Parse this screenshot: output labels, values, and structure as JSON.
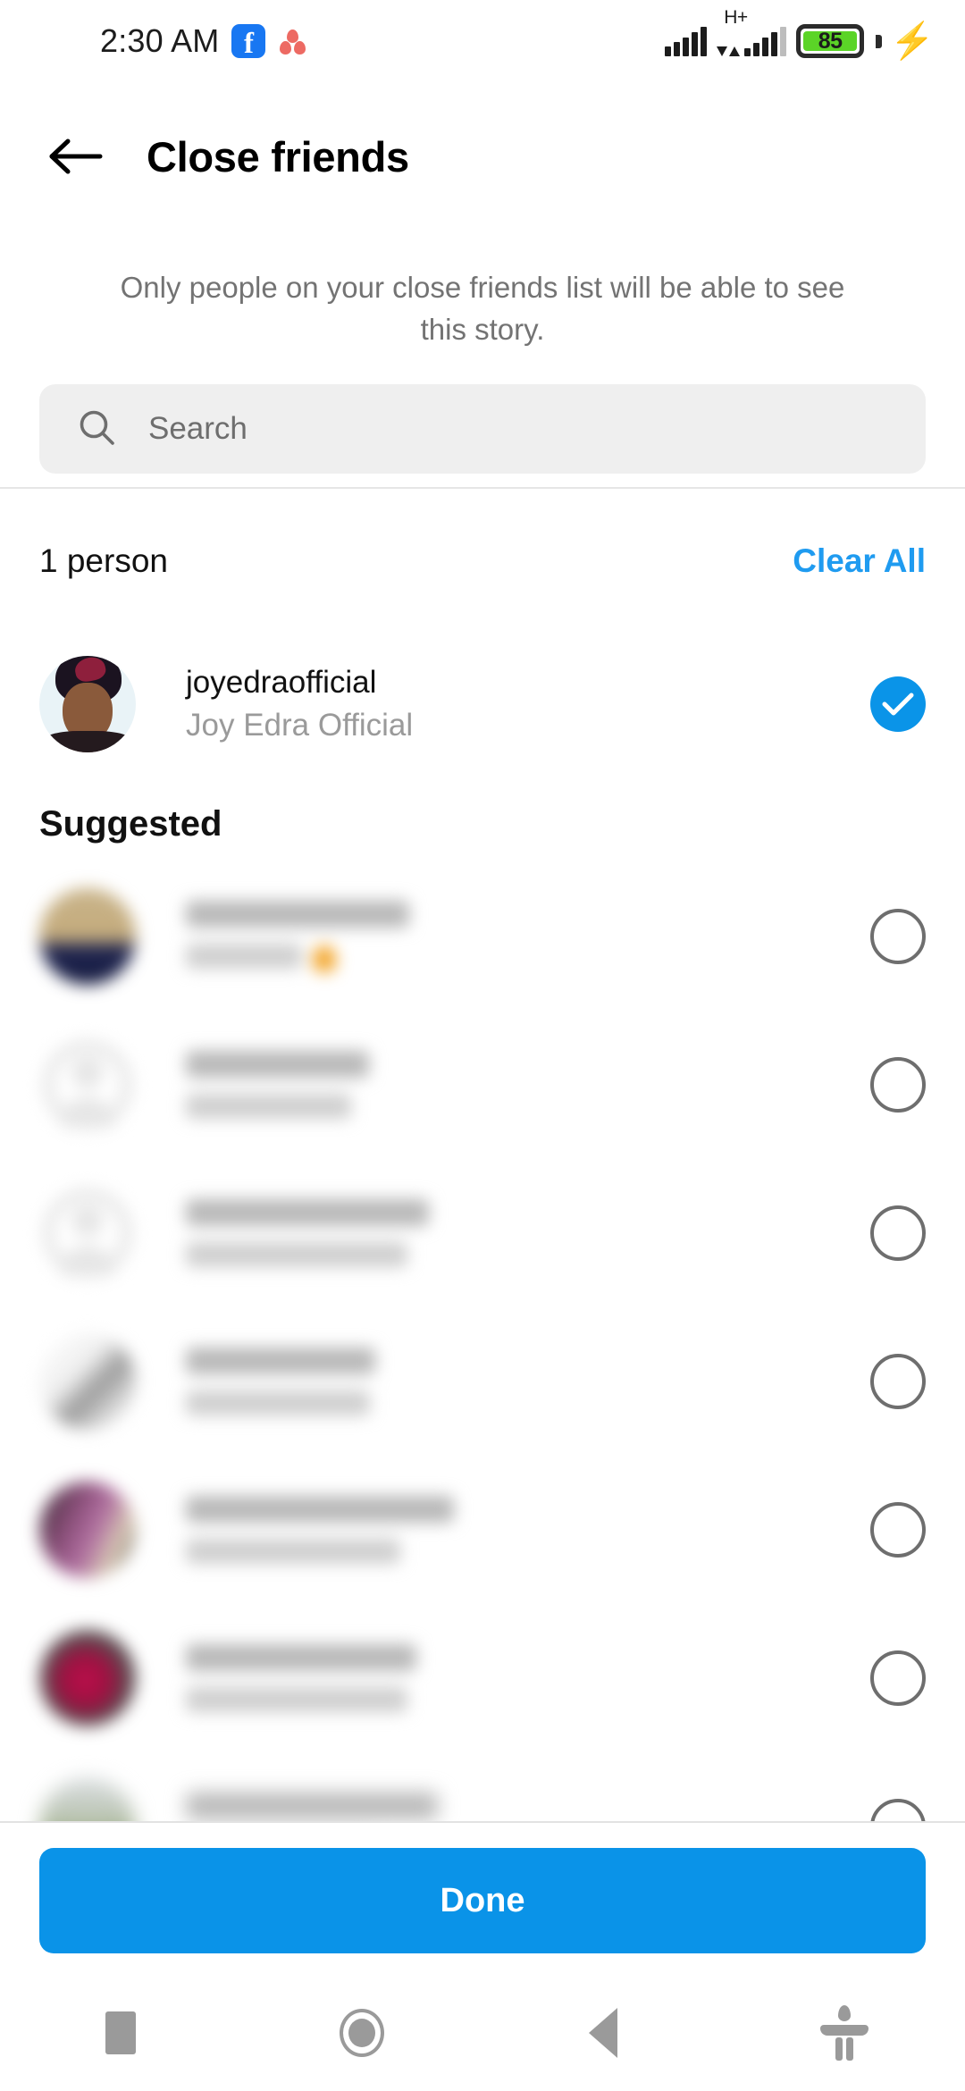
{
  "status_bar": {
    "time": "2:30 AM",
    "facebook_glyph": "f",
    "icons": [
      "facebook-icon",
      "cluster-dots-icon"
    ],
    "network_label": "H+",
    "battery_level": "85",
    "battery_color": "#5BD427",
    "charging": true
  },
  "header": {
    "back_icon": "back-arrow-icon",
    "title": "Close friends"
  },
  "description": "Only people on your close friends list will be able to see this story.",
  "search": {
    "icon": "search-icon",
    "placeholder": "Search",
    "value": ""
  },
  "list_summary": {
    "count_label": "1 person",
    "clear_all_label": "Clear All"
  },
  "selected": [
    {
      "username": "joyedraofficial",
      "fullname": "Joy Edra Official",
      "selected": true,
      "avatar": "photo-joy"
    }
  ],
  "suggested": {
    "title": "Suggested",
    "items": [
      {
        "username": "",
        "fullname": "",
        "selected": false,
        "avatar": "photo-tan-navy",
        "redacted": true,
        "has_emoji": true
      },
      {
        "username": "",
        "fullname": "",
        "selected": false,
        "avatar": "placeholder-silhouette",
        "redacted": true,
        "has_emoji": false
      },
      {
        "username": "",
        "fullname": "",
        "selected": false,
        "avatar": "placeholder-silhouette",
        "redacted": true,
        "has_emoji": false
      },
      {
        "username": "",
        "fullname": "",
        "selected": false,
        "avatar": "photo-light",
        "redacted": true,
        "has_emoji": false
      },
      {
        "username": "",
        "fullname": "",
        "selected": false,
        "avatar": "photo-purple",
        "redacted": true,
        "has_emoji": false
      },
      {
        "username": "",
        "fullname": "",
        "selected": false,
        "avatar": "photo-crimson",
        "redacted": true,
        "has_emoji": false
      },
      {
        "username": "",
        "fullname": "",
        "selected": false,
        "avatar": "photo-outdoor",
        "redacted": true,
        "has_emoji": false
      }
    ]
  },
  "footer": {
    "done_label": "Done",
    "done_color": "#0A93E8"
  },
  "nav_bar": {
    "items": [
      "recents-square-icon",
      "home-circle-icon",
      "back-triangle-icon",
      "accessibility-icon"
    ]
  },
  "colors": {
    "accent_blue": "#0A94E8",
    "link_blue": "#1F9BF0",
    "muted_text": "#9a9a9a",
    "search_bg": "#EFEFEF"
  }
}
